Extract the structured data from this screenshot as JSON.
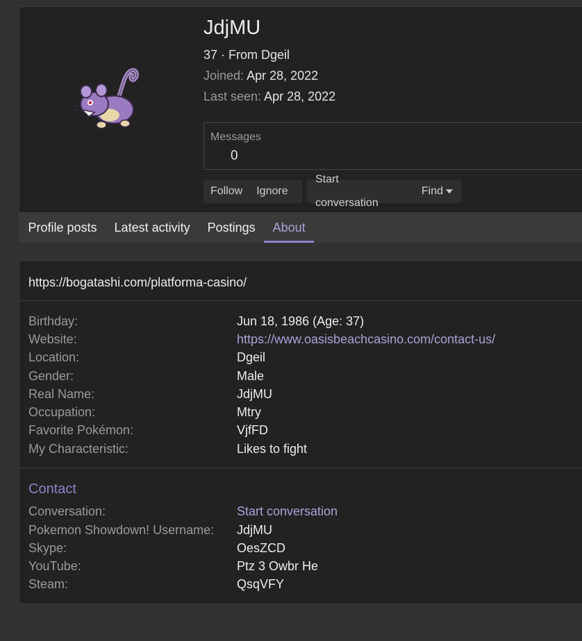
{
  "profile": {
    "username": "JdjMU",
    "age_location": "37 · From Dgeil",
    "joined_label": "Joined:",
    "joined_value": "Apr 28, 2022",
    "last_seen_label": "Last seen:",
    "last_seen_value": "Apr 28, 2022",
    "messages_label": "Messages",
    "messages_value": "0",
    "avatar_icon": "rattata-sprite-icon"
  },
  "actions": {
    "follow": "Follow",
    "ignore": "Ignore",
    "start_conversation": "Start conversation",
    "find": "Find"
  },
  "tabs": [
    {
      "label": "Profile posts",
      "active": false
    },
    {
      "label": "Latest activity",
      "active": false
    },
    {
      "label": "Postings",
      "active": false
    },
    {
      "label": "About",
      "active": true
    }
  ],
  "about": {
    "url": "https://bogatashi.com/platforma-casino/",
    "fields": [
      {
        "label": "Birthday:",
        "value": "Jun 18, 1986 (Age: 37)"
      },
      {
        "label": "Website:",
        "value": "https://www.oasisbeachcasino.com/contact-us/"
      },
      {
        "label": "Location:",
        "value": "Dgeil"
      },
      {
        "label": "Gender:",
        "value": "Male"
      },
      {
        "label": "Real Name:",
        "value": "JdjMU"
      },
      {
        "label": "Occupation:",
        "value": "Mtry"
      },
      {
        "label": "Favorite Pokémon:",
        "value": "VjfFD"
      },
      {
        "label": "My Characteristic:",
        "value": "Likes to fight"
      }
    ]
  },
  "contact": {
    "title": "Contact",
    "fields": [
      {
        "label": "Conversation:",
        "value": "Start conversation"
      },
      {
        "label": "Pokemon Showdown! Username:",
        "value": "JdjMU"
      },
      {
        "label": "Skype:",
        "value": "OesZCD"
      },
      {
        "label": "YouTube:",
        "value": "Ptz 3 Owbr He"
      },
      {
        "label": "Steam:",
        "value": "QsqVFY"
      }
    ]
  },
  "colors": {
    "background": "#313131",
    "panel": "#222222",
    "accent": "#8b84c9",
    "link": "#a8a3d8"
  }
}
